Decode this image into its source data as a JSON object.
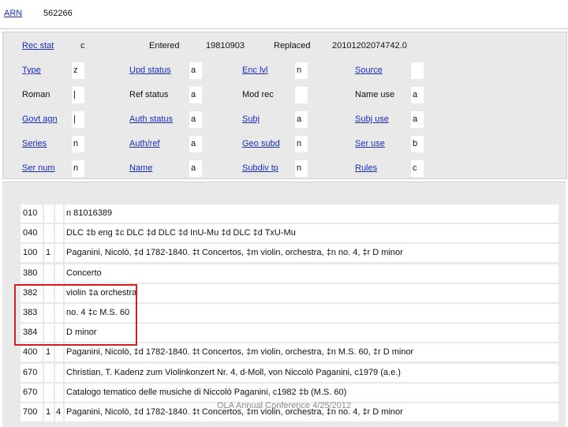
{
  "header": {
    "arn_label": "ARN",
    "arn_value": "562266"
  },
  "fixed": {
    "rec_stat_label": "Rec stat",
    "rec_stat_value": "c",
    "entered_label": "Entered",
    "entered_value": "19810903",
    "replaced_label": "Replaced",
    "replaced_value": "20101202074742.0",
    "rows": [
      [
        {
          "label": "Type",
          "value": "z",
          "link": true
        },
        {
          "label": "Upd status",
          "value": "a",
          "link": true
        },
        {
          "label": "Enc lvl",
          "value": "n",
          "link": true
        },
        {
          "label": "Source",
          "value": "",
          "link": true
        }
      ],
      [
        {
          "label": "Roman",
          "value": "|",
          "link": false
        },
        {
          "label": "Ref status",
          "value": "a",
          "link": false
        },
        {
          "label": "Mod rec",
          "value": "",
          "link": false
        },
        {
          "label": "Name use",
          "value": "a",
          "link": false
        }
      ],
      [
        {
          "label": "Govt agn",
          "value": "|",
          "link": true
        },
        {
          "label": "Auth status",
          "value": "a",
          "link": true
        },
        {
          "label": "Subj",
          "value": "a",
          "link": true
        },
        {
          "label": "Subj use",
          "value": "a",
          "link": true
        }
      ],
      [
        {
          "label": "Series",
          "value": "n",
          "link": true
        },
        {
          "label": "Auth/ref",
          "value": "a",
          "link": true
        },
        {
          "label": "Geo subd",
          "value": "n",
          "link": true
        },
        {
          "label": "Ser use",
          "value": "b",
          "link": true
        }
      ],
      [
        {
          "label": "Ser num",
          "value": "n",
          "link": true
        },
        {
          "label": "Name",
          "value": "a",
          "link": true
        },
        {
          "label": "Subdiv tp",
          "value": "n",
          "link": true
        },
        {
          "label": "Rules",
          "value": "c",
          "link": true
        }
      ]
    ]
  },
  "fields": [
    {
      "tag": "010",
      "ind1": "",
      "ind2": "",
      "data": "n  81016389"
    },
    {
      "tag": "040",
      "ind1": "",
      "ind2": "",
      "data": "DLC ‡b eng ‡c DLC ‡d DLC ‡d InU-Mu ‡d DLC ‡d TxU-Mu"
    },
    {
      "tag": "100",
      "ind1": "1",
      "ind2": "",
      "data": "Paganini, Nicolò, ‡d 1782-1840. ‡t Concertos, ‡m violin, orchestra, ‡n no. 4, ‡r D minor"
    },
    {
      "tag": "380",
      "ind1": "",
      "ind2": "",
      "data": "Concerto"
    },
    {
      "tag": "382",
      "ind1": "",
      "ind2": "",
      "data": "violin ‡a orchestra"
    },
    {
      "tag": "383",
      "ind1": "",
      "ind2": "",
      "data": "no. 4 ‡c M.S. 60"
    },
    {
      "tag": "384",
      "ind1": "",
      "ind2": "",
      "data": "D minor"
    },
    {
      "tag": "400",
      "ind1": "1",
      "ind2": "",
      "data": "Paganini, Nicolò, ‡d 1782-1840. ‡t Concertos, ‡m violin, orchestra, ‡n M.S. 60, ‡r D minor"
    },
    {
      "tag": "670",
      "ind1": "",
      "ind2": "",
      "data": "Christian, T. Kadenz zum Violinkonzert Nr. 4, d-Moll, von Niccolò Paganini, c1979 (a.e.)"
    },
    {
      "tag": "670",
      "ind1": "",
      "ind2": "",
      "data": "Catalogo tematico delle musiche di Niccolò Paganini, c1982 ‡b (M.S. 60)"
    },
    {
      "tag": "700",
      "ind1": "1",
      "ind2": "4",
      "data": "Paganini, Nicolò, ‡d 1782-1840. ‡t Concertos, ‡m violin, orchestra, ‡n no. 4, ‡r D minor"
    }
  ],
  "footer": "OLA Annual Conference 4/25/2012"
}
